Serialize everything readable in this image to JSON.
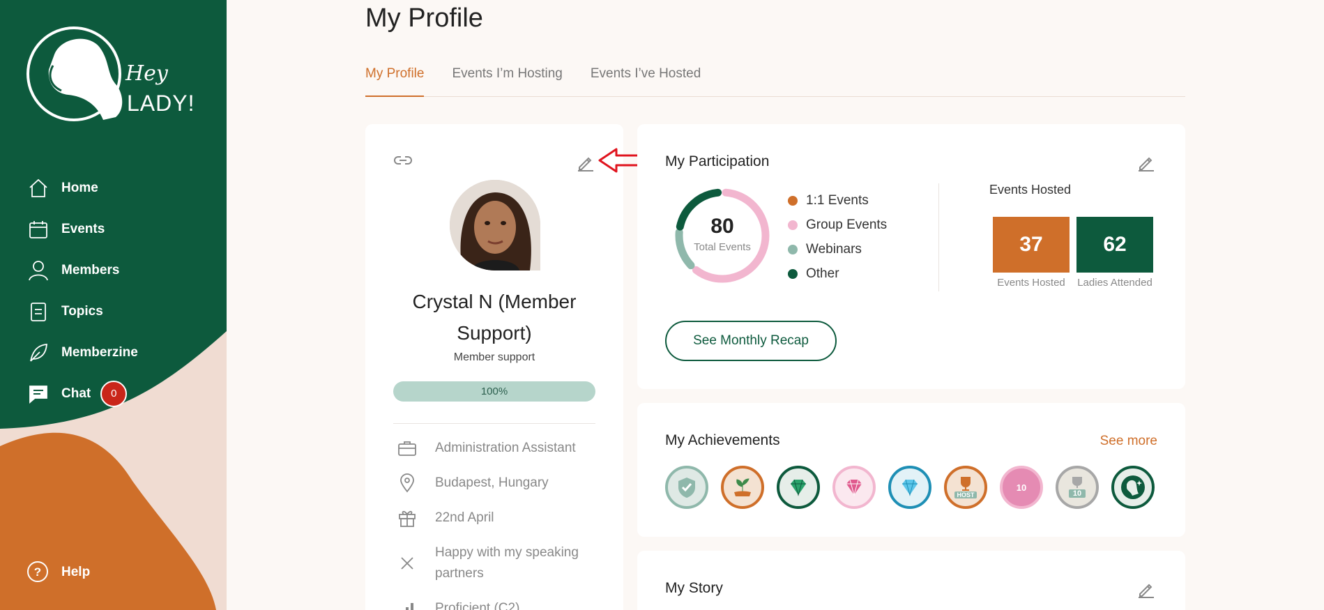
{
  "logo": {
    "line1": "Hey",
    "line2": "LADY!"
  },
  "sidebar": {
    "items": [
      {
        "label": "Home",
        "icon": "home-icon"
      },
      {
        "label": "Events",
        "icon": "calendar-icon"
      },
      {
        "label": "Members",
        "icon": "user-icon"
      },
      {
        "label": "Topics",
        "icon": "document-icon"
      },
      {
        "label": "Memberzine",
        "icon": "leaf-icon"
      },
      {
        "label": "Chat",
        "icon": "chat-icon",
        "badge": "0"
      }
    ],
    "help": "Help"
  },
  "page": {
    "title": "My Profile"
  },
  "tabs": [
    {
      "label": "My Profile",
      "active": true
    },
    {
      "label": "Events I’m Hosting",
      "active": false
    },
    {
      "label": "Events I’ve Hosted",
      "active": false
    }
  ],
  "profile": {
    "name": "Crystal N (Member Support)",
    "role": "Member support",
    "completion": "100%",
    "details": [
      {
        "icon": "briefcase-icon",
        "text": "Administration Assistant"
      },
      {
        "icon": "location-icon",
        "text": "Budapest, Hungary"
      },
      {
        "icon": "gift-icon",
        "text": "22nd April"
      },
      {
        "icon": "close-icon",
        "text": "Happy with my speaking partners"
      },
      {
        "icon": "level-icon",
        "text": "Proficient (C2)"
      }
    ]
  },
  "participation": {
    "title": "My Participation",
    "total": "80",
    "total_label": "Total Events",
    "legend": [
      {
        "label": "1:1 Events",
        "color": "#cf6f2a"
      },
      {
        "label": "Group Events",
        "color": "#f2b6cf"
      },
      {
        "label": "Webinars",
        "color": "#8fb8ab"
      },
      {
        "label": "Other",
        "color": "#0d5a3d"
      }
    ],
    "events_hosted_title": "Events Hosted",
    "stats": [
      {
        "value": "37",
        "label": "Events Hosted",
        "color": "#cf6f2a"
      },
      {
        "value": "62",
        "label": "Ladies Attended",
        "color": "#0d5a3d"
      }
    ],
    "recap_button": "See Monthly Recap"
  },
  "achievements": {
    "title": "My Achievements",
    "see_more": "See more",
    "badges": [
      {
        "icon": "shield-check-icon",
        "ring": "#8fb8ab",
        "fill": "#dfe9e5",
        "text": ""
      },
      {
        "icon": "sprout-icon",
        "ring": "#cf6f2a",
        "fill": "#f4e2d2",
        "text": ""
      },
      {
        "icon": "emerald-icon",
        "ring": "#0d5a3d",
        "fill": "#e6eee9",
        "text": ""
      },
      {
        "icon": "pink-gem-icon",
        "ring": "#f2b6cf",
        "fill": "#fbe8ef",
        "text": ""
      },
      {
        "icon": "blue-gem-icon",
        "ring": "#1e8fb5",
        "fill": "#e3f2f7",
        "text": ""
      },
      {
        "icon": "host-trophy-icon",
        "ring": "#cf6f2a",
        "fill": "#f4e2d2",
        "text": "HOST"
      },
      {
        "icon": "ribbon-10-icon",
        "ring": "#e58bb3",
        "fill": "#e58bb3",
        "text": "10"
      },
      {
        "icon": "trophy-10-icon",
        "ring": "#a7a7a7",
        "fill": "#e9e6de",
        "text": "10"
      },
      {
        "icon": "lady-sparkle-icon",
        "ring": "#0d5a3d",
        "fill": "#e6eee9",
        "text": ""
      }
    ]
  },
  "story": {
    "title": "My Story"
  }
}
